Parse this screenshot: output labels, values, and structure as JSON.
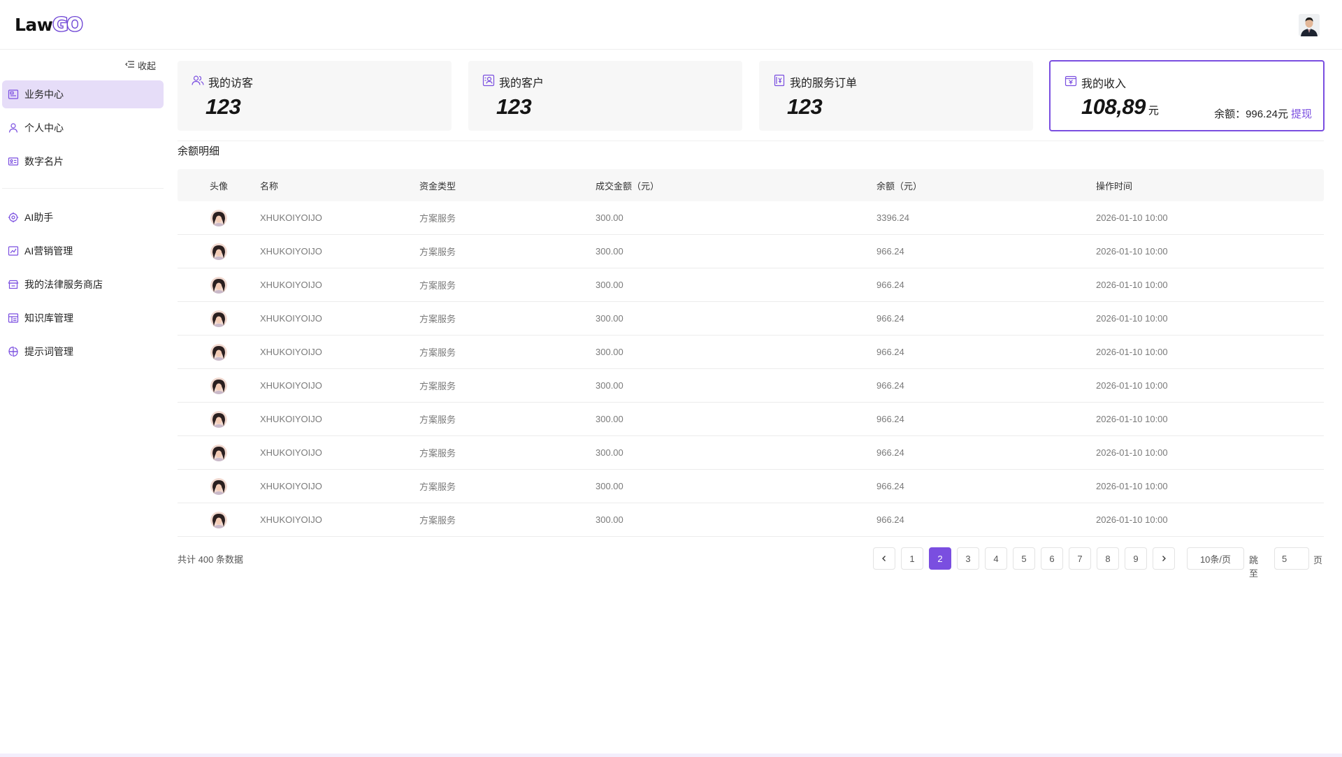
{
  "app": {
    "logo_left": "Law",
    "logo_right": "GO"
  },
  "header": {
    "avatar_icon": "user-avatar-icon"
  },
  "sidebar": {
    "collapse_label": "收起",
    "items": [
      {
        "label": "业务中心",
        "icon": "dashboard-icon",
        "active": true
      },
      {
        "label": "个人中心",
        "icon": "user-icon"
      },
      {
        "label": "数字名片",
        "icon": "card-icon"
      },
      {
        "label": "AI助手",
        "icon": "ai-icon"
      },
      {
        "label": "AI营销管理",
        "icon": "chart-icon"
      },
      {
        "label": "我的法律服务商店",
        "icon": "store-icon"
      },
      {
        "label": "知识库管理",
        "icon": "book-icon"
      },
      {
        "label": "提示词管理",
        "icon": "prompt-icon"
      }
    ]
  },
  "stats": [
    {
      "title": "我的访客",
      "value": "123"
    },
    {
      "title": "我的客户",
      "value": "123"
    },
    {
      "title": "我的服务订单",
      "value": "123"
    },
    {
      "title": "我的收入",
      "value": "108,89",
      "unit": "元",
      "balance_label": "余额：996.24元",
      "withdraw": "提现"
    }
  ],
  "section": {
    "title": "余额明细"
  },
  "table": {
    "headers": [
      "头像",
      "名称",
      "资金类型",
      "成交金额（元）",
      "余额（元）",
      "操作时间"
    ],
    "rows": [
      {
        "name": "XHUKOIYOIJO",
        "type": "方案服务",
        "amount": "300.00",
        "balance": "3396.24",
        "time": "2026-01-10 10:00"
      },
      {
        "name": "XHUKOIYOIJO",
        "type": "方案服务",
        "amount": "300.00",
        "balance": "966.24",
        "time": "2026-01-10 10:00"
      },
      {
        "name": "XHUKOIYOIJO",
        "type": "方案服务",
        "amount": "300.00",
        "balance": "966.24",
        "time": "2026-01-10 10:00"
      },
      {
        "name": "XHUKOIYOIJO",
        "type": "方案服务",
        "amount": "300.00",
        "balance": "966.24",
        "time": "2026-01-10 10:00"
      },
      {
        "name": "XHUKOIYOIJO",
        "type": "方案服务",
        "amount": "300.00",
        "balance": "966.24",
        "time": "2026-01-10 10:00"
      },
      {
        "name": "XHUKOIYOIJO",
        "type": "方案服务",
        "amount": "300.00",
        "balance": "966.24",
        "time": "2026-01-10 10:00"
      },
      {
        "name": "XHUKOIYOIJO",
        "type": "方案服务",
        "amount": "300.00",
        "balance": "966.24",
        "time": "2026-01-10 10:00"
      },
      {
        "name": "XHUKOIYOIJO",
        "type": "方案服务",
        "amount": "300.00",
        "balance": "966.24",
        "time": "2026-01-10 10:00"
      },
      {
        "name": "XHUKOIYOIJO",
        "type": "方案服务",
        "amount": "300.00",
        "balance": "966.24",
        "time": "2026-01-10 10:00"
      },
      {
        "name": "XHUKOIYOIJO",
        "type": "方案服务",
        "amount": "300.00",
        "balance": "966.24",
        "time": "2026-01-10 10:00"
      }
    ]
  },
  "footer": {
    "total": "共计 400 条数据",
    "pages": [
      "1",
      "2",
      "3",
      "4",
      "5",
      "6",
      "7",
      "8",
      "9"
    ],
    "current_page": "2",
    "page_size": "10条/页",
    "jump_label": "跳至",
    "jump_value": "5",
    "page_unit": "页"
  },
  "colors": {
    "accent": "#7a4ee0",
    "active_nav_bg": "#e6ddf8",
    "card_bg": "#f7f7f7"
  }
}
